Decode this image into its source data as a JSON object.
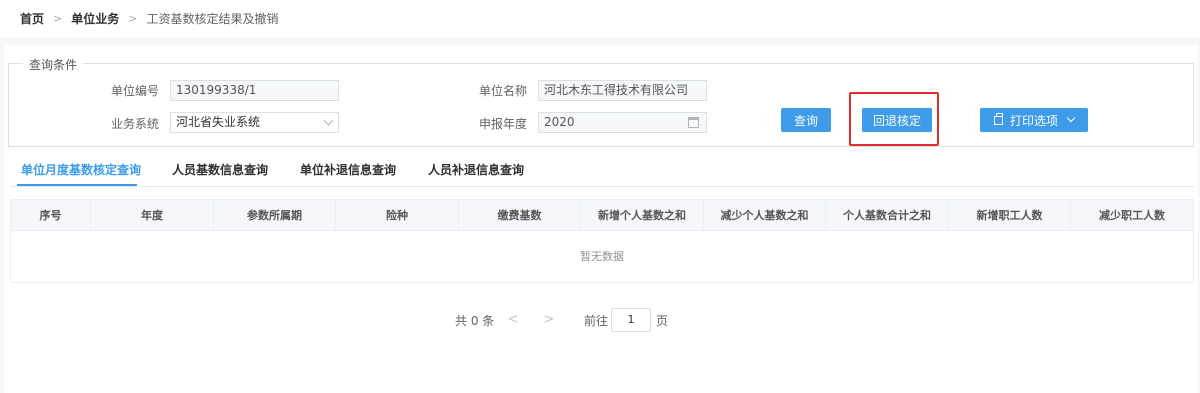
{
  "breadcrumb": {
    "home": "首页",
    "section": "单位业务",
    "current": "工资基数核定结果及撤销"
  },
  "query": {
    "legend": "查询条件",
    "unit_code_label": "单位编号",
    "unit_code_value": "130199338/1",
    "unit_name_label": "单位名称",
    "unit_name_value": "河北木东工得技术有限公司",
    "business_system_label": "业务系统",
    "business_system_value": "河北省失业系统",
    "year_label": "申报年度",
    "year_value": "2020"
  },
  "buttons": {
    "query": "查询",
    "revoke": "回退核定",
    "print": "打印选项"
  },
  "tabs": [
    "单位月度基数核定查询",
    "人员基数信息查询",
    "单位补退信息查询",
    "人员补退信息查询"
  ],
  "table": {
    "columns": [
      "序号",
      "年度",
      "参数所属期",
      "险种",
      "缴费基数",
      "新增个人基数之和",
      "减少个人基数之和",
      "个人基数合计之和",
      "新增职工人数",
      "减少职工人数"
    ],
    "empty_text": "暂无数据"
  },
  "pagination": {
    "total": "共 0 条",
    "prev": "<",
    "next": ">",
    "goto_label": "前往",
    "page": "1",
    "page_unit": "页"
  },
  "colors": {
    "accent": "#3d9be9",
    "highlight": "#e52a2a"
  }
}
